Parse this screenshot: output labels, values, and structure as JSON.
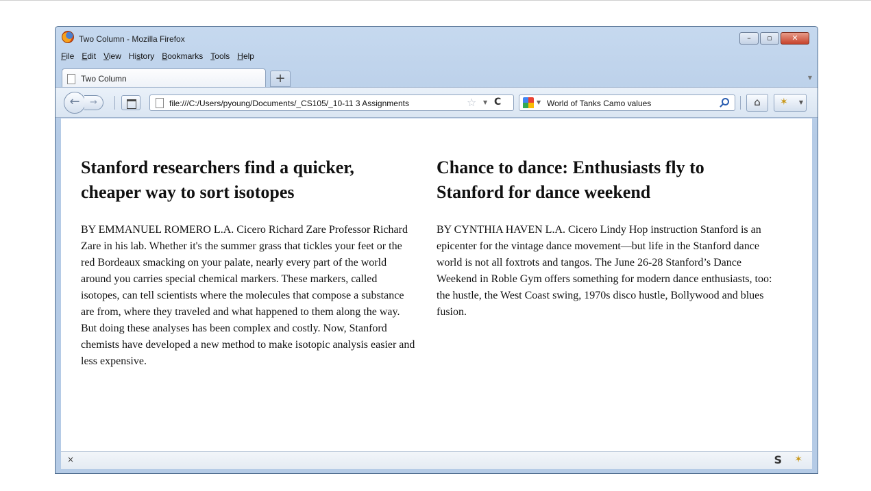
{
  "window": {
    "title": "Two Column - Mozilla Firefox",
    "controls": {
      "minimize": "–",
      "maximize": "▫",
      "close": "✕"
    }
  },
  "menubar": [
    {
      "pre": "",
      "acc": "F",
      "post": "ile"
    },
    {
      "pre": "",
      "acc": "E",
      "post": "dit"
    },
    {
      "pre": "",
      "acc": "V",
      "post": "iew"
    },
    {
      "pre": "Hi",
      "acc": "s",
      "post": "tory"
    },
    {
      "pre": "",
      "acc": "B",
      "post": "ookmarks"
    },
    {
      "pre": "",
      "acc": "T",
      "post": "ools"
    },
    {
      "pre": "",
      "acc": "H",
      "post": "elp"
    }
  ],
  "tabs": [
    {
      "label": "Two Column"
    }
  ],
  "new_tab_label": "+",
  "navbar": {
    "url": "file:///C:/Users/pyoung/Documents/_CS105/_10-11 3 Assignments",
    "search_text": "World of Tanks Camo values",
    "back": "←",
    "forward": "→",
    "reload": "C",
    "home": "⌂"
  },
  "articles": [
    {
      "headline": "Stanford researchers find a quicker, cheaper way to sort isotopes",
      "body": "BY EMMANUEL ROMERO L.A. Cicero Richard Zare Professor Richard Zare in his lab. Whether it's the summer grass that tickles your feet or the red Bordeaux smacking on your palate, nearly every part of the world around you carries special chemical markers. These markers, called isotopes, can tell scientists where the molecules that compose a substance are from, where they traveled and what happened to them along the way. But doing these analyses has been complex and costly. Now, Stanford chemists have developed a new method to make isotopic analysis easier and less expensive."
    },
    {
      "headline": "Chance to dance: Enthusiasts fly to Stanford for dance weekend",
      "body": "BY CYNTHIA HAVEN L.A. Cicero Lindy Hop instruction Stanford is an epicenter for the vintage dance movement—but life in the Stanford dance world is not all foxtrots and tangos. The June 26-28 Stanford’s Dance Weekend in Roble Gym offers something for modern dance enthusiasts, too: the hustle, the West Coast swing, 1970s disco hustle, Bollywood and blues fusion."
    }
  ],
  "statusbar": {
    "close": "×",
    "s_icon": "S"
  }
}
